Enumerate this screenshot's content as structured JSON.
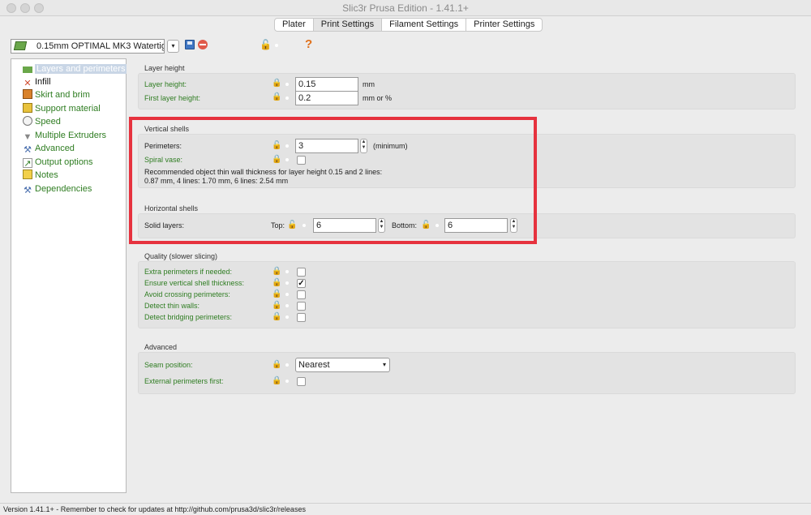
{
  "window": {
    "title": "Slic3r Prusa Edition - 1.41.1+"
  },
  "tabs": [
    {
      "label": "Plater"
    },
    {
      "label": "Print Settings"
    },
    {
      "label": "Filament Settings"
    },
    {
      "label": "Printer Settings"
    }
  ],
  "preset": {
    "name": "0.15mm OPTIMAL MK3 Watertig"
  },
  "help_icon_glyph": "?",
  "sidebar": {
    "items": [
      {
        "label": "Layers and perimeters",
        "icon": "layers-icon"
      },
      {
        "label": "Infill",
        "icon": "infill-icon"
      },
      {
        "label": "Skirt and brim",
        "icon": "skirt-icon"
      },
      {
        "label": "Support material",
        "icon": "support-icon"
      },
      {
        "label": "Speed",
        "icon": "speed-icon"
      },
      {
        "label": "Multiple Extruders",
        "icon": "funnel-icon"
      },
      {
        "label": "Advanced",
        "icon": "wrench-icon"
      },
      {
        "label": "Output options",
        "icon": "output-icon"
      },
      {
        "label": "Notes",
        "icon": "notes-icon"
      },
      {
        "label": "Dependencies",
        "icon": "wrench-icon"
      }
    ]
  },
  "layer_height": {
    "title": "Layer height",
    "layer_height_label": "Layer height:",
    "layer_height_value": "0.15",
    "layer_height_unit": "mm",
    "first_layer_label": "First layer height:",
    "first_layer_value": "0.2",
    "first_layer_unit": "mm or %"
  },
  "vertical_shells": {
    "title": "Vertical shells",
    "perimeters_label": "Perimeters:",
    "perimeters_value": "3",
    "perimeters_unit": "(minimum)",
    "spiral_label": "Spiral vase:",
    "spiral_checked": false,
    "info_line1": "Recommended object thin wall thickness for layer height 0.15 and 2 lines:",
    "info_line2": "0.87 mm, 4 lines: 1.70 mm, 6 lines: 2.54 mm"
  },
  "horizontal_shells": {
    "title": "Horizontal shells",
    "solid_label": "Solid layers:",
    "top_label": "Top:",
    "top_value": "6",
    "bottom_label": "Bottom:",
    "bottom_value": "6"
  },
  "quality": {
    "title": "Quality (slower slicing)",
    "items": [
      {
        "label": "Extra perimeters if needed:",
        "checked": false
      },
      {
        "label": "Ensure vertical shell thickness:",
        "checked": true
      },
      {
        "label": "Avoid crossing perimeters:",
        "checked": false
      },
      {
        "label": "Detect thin walls:",
        "checked": false
      },
      {
        "label": "Detect bridging perimeters:",
        "checked": false
      }
    ]
  },
  "advanced": {
    "title": "Advanced",
    "seam_label": "Seam position:",
    "seam_value": "Nearest",
    "external_first_label": "External perimeters first:",
    "external_first_checked": false
  },
  "status": {
    "text": "Version 1.41.1+ - Remember to check for updates at http://github.com/prusa3d/slic3r/releases"
  },
  "colors": {
    "highlight": "#e6323e",
    "label_green": "#2f7d22"
  }
}
